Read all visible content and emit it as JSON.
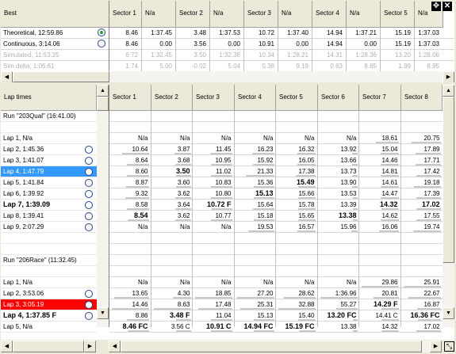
{
  "top": {
    "corner_label": "Best",
    "headers": [
      "Sector 1",
      "N/a",
      "Sector 2",
      "N/a",
      "Sector 3",
      "N/a",
      "Sector 4",
      "N/a",
      "Sector 5",
      "N/a"
    ],
    "rows": [
      {
        "label": "Theoretical, 12:59.86",
        "radio": "on",
        "style": "normal",
        "vals": [
          "8.46",
          "1:37.45",
          "3.48",
          "1:37.53",
          "10.72",
          "1:37.40",
          "14.94",
          "1:37.21",
          "15.19",
          "1:37.03"
        ]
      },
      {
        "label": "Continuous, 3:14.06",
        "radio": "off",
        "style": "normal",
        "vals": [
          "8.46",
          "0.00",
          "3.56",
          "0.00",
          "10.91",
          "0.00",
          "14.94",
          "0.00",
          "15.19",
          "1:37.03"
        ]
      },
      {
        "label": "Simulated, 11:53.25",
        "radio": "none",
        "style": "gray",
        "vals": [
          "6.72",
          "1:32.45",
          "3.50",
          "1:32.38",
          "10.34",
          "1:28.21",
          "14.31",
          "1:28.36",
          "13.20",
          "1:28.06"
        ]
      },
      {
        "label": "Sim delta, 1:06.61",
        "radio": "none",
        "style": "gray",
        "vals": [
          "1.74",
          "5.00",
          "-0.02",
          "5.04",
          "0.38",
          "9.19",
          "0.63",
          "8.85",
          "1.99",
          "8.95"
        ]
      }
    ]
  },
  "window_icons": {
    "move": "move-icon",
    "close": "close-icon"
  },
  "bottom": {
    "corner_label": "Lap times",
    "headers": [
      "Sector 1",
      "Sector 2",
      "Sector 3",
      "Sector 4",
      "Sector 5",
      "Sector 6",
      "Sector 7",
      "Sector 8"
    ],
    "rows": [
      {
        "label": "Run \"203Qual\" (16:41.00)",
        "kind": "run",
        "vals": []
      },
      {
        "label": "",
        "kind": "blank",
        "vals": []
      },
      {
        "label": "Lap 1, N/a",
        "kind": "lap",
        "radio": false,
        "vals": [
          "N/a",
          "N/a",
          "N/a",
          "N/a",
          "N/a",
          "N/a",
          "18.61",
          "20.75"
        ]
      },
      {
        "label": "Lap 2, 1:45.36",
        "kind": "lap",
        "radio": true,
        "vals": [
          "10.64",
          "3.87",
          "11.45",
          "16.23",
          "16.32",
          "13.92",
          "15.04",
          "17.89"
        ]
      },
      {
        "label": "Lap 3, 1:41.07",
        "kind": "lap",
        "radio": true,
        "vals": [
          "8.64",
          "3.68",
          "10.95",
          "15.92",
          "16.05",
          "13.66",
          "14.46",
          "17.71"
        ]
      },
      {
        "label": "Lap 4, 1:47.79",
        "kind": "lap",
        "radio": true,
        "hl": "blue",
        "vals": [
          "8.60",
          "3.50",
          "11.02",
          "21.33",
          "17.38",
          "13.73",
          "14.81",
          "17.42"
        ],
        "bold": [
          1
        ]
      },
      {
        "label": "Lap 5, 1:41.84",
        "kind": "lap",
        "radio": true,
        "vals": [
          "8.87",
          "3.60",
          "10.83",
          "15.36",
          "15.49",
          "13.90",
          "14.61",
          "19.18"
        ],
        "bold": [
          4
        ]
      },
      {
        "label": "Lap 6, 1:39.92",
        "kind": "lap",
        "radio": true,
        "vals": [
          "9.32",
          "3.62",
          "10.80",
          "15.13",
          "15.66",
          "13.53",
          "14.47",
          "17.39"
        ],
        "bold": [
          3
        ]
      },
      {
        "label": "Lap 7, 1:39.09",
        "kind": "lap",
        "radio": true,
        "labelbold": true,
        "vals": [
          "8.58",
          "3.64",
          "10.72 F",
          "15.64",
          "15.78",
          "13.39",
          "14.32",
          "17.02"
        ],
        "bold": [
          2,
          6,
          7
        ]
      },
      {
        "label": "Lap 8, 1:39.41",
        "kind": "lap",
        "radio": true,
        "vals": [
          "8.54",
          "3.62",
          "10.77",
          "15.18",
          "15.65",
          "13.38",
          "14.62",
          "17.55"
        ],
        "bold": [
          0,
          5
        ]
      },
      {
        "label": "Lap 9, 2:07.29",
        "kind": "lap",
        "radio": true,
        "vals": [
          "N/a",
          "N/a",
          "N/a",
          "19.53",
          "16.57",
          "15.96",
          "16.06",
          "19.74"
        ]
      },
      {
        "label": "",
        "kind": "blank",
        "vals": []
      },
      {
        "label": "",
        "kind": "blank",
        "vals": []
      },
      {
        "label": "Run \"206Race\" (11:32.45)",
        "kind": "run",
        "vals": []
      },
      {
        "label": "",
        "kind": "blank",
        "vals": []
      },
      {
        "label": "Lap 1, N/a",
        "kind": "lap",
        "radio": false,
        "vals": [
          "N/a",
          "N/a",
          "N/a",
          "N/a",
          "N/a",
          "N/a",
          "29.86",
          "25.91"
        ]
      },
      {
        "label": "Lap 2, 3:53.06",
        "kind": "lap",
        "radio": true,
        "vals": [
          "13.65",
          "4.30",
          "18.85",
          "27.20",
          "28.62",
          "1:36.96",
          "20.81",
          "22.67"
        ]
      },
      {
        "label": "Lap 3, 3:05.19",
        "kind": "lap",
        "radio": true,
        "hl": "red",
        "vals": [
          "14.46",
          "8.63",
          "17.48",
          "25.31",
          "32.88",
          "55.27",
          "14.29 F",
          "16.87"
        ],
        "bold": [
          6
        ]
      },
      {
        "label": "Lap 4, 1:37.85 F",
        "kind": "lap",
        "radio": true,
        "labelbold": true,
        "vals": [
          "8.86",
          "3.48 F",
          "11.04",
          "15.13",
          "15.40",
          "13.20 FC",
          "14.41 C",
          "16.36 FC"
        ],
        "bold": [
          1,
          5,
          7
        ]
      },
      {
        "label": "Lap 5, N/a",
        "kind": "lap",
        "radio": false,
        "vals": [
          "8.46 FC",
          "3.56 C",
          "10.91 C",
          "14.94 FC",
          "15.19 FC",
          "13.38",
          "14.32",
          "17.02"
        ],
        "bold": [
          0,
          2,
          3,
          4
        ]
      }
    ]
  },
  "colors": {
    "blue_highlight": "#3399ff",
    "red_highlight": "#ff0000",
    "radio_on": "#2a9d2a"
  }
}
